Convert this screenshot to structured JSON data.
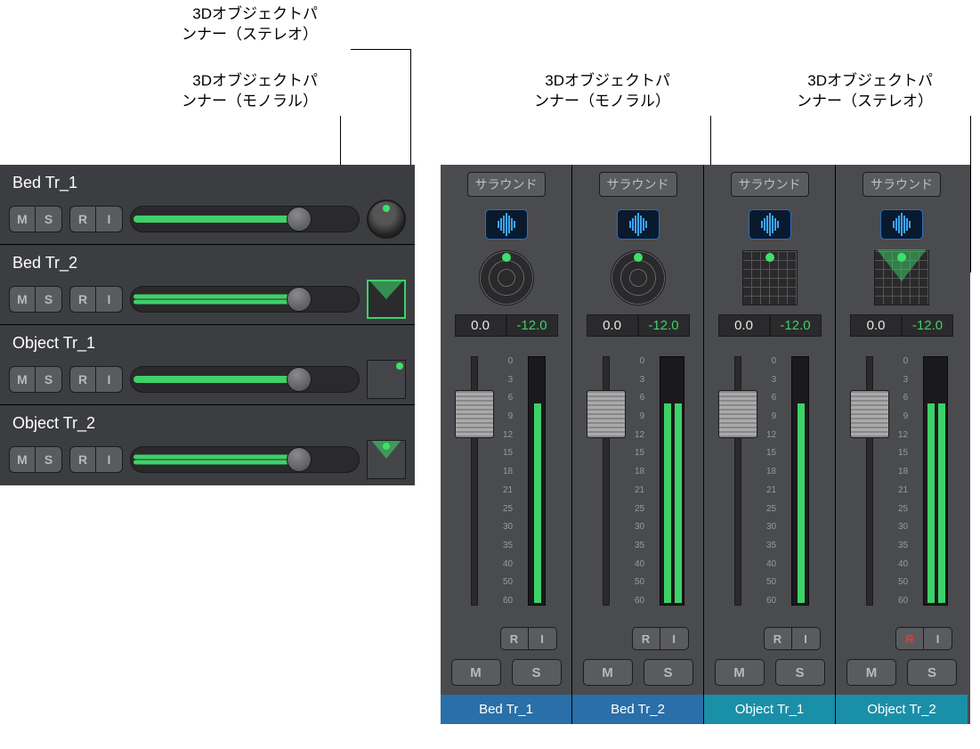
{
  "callouts": {
    "left_mono": "3Dオブジェクトパ\nンナー（モノラル）",
    "left_stereo": "3Dオブジェクトパ\nンナー（ステレオ）",
    "right_mono": "3Dオブジェクトパ\nンナー（モノラル）",
    "right_stereo": "3Dオブジェクトパ\nンナー（ステレオ）"
  },
  "tracks": [
    {
      "name": "Bed Tr_1",
      "stereo": false,
      "panner": "round"
    },
    {
      "name": "Bed Tr_2",
      "stereo": true,
      "panner": "surround"
    },
    {
      "name": "Object Tr_1",
      "stereo": false,
      "panner": "mono3d"
    },
    {
      "name": "Object Tr_2",
      "stereo": true,
      "panner": "stereo3d"
    }
  ],
  "track_buttons": {
    "M": "M",
    "S": "S",
    "R": "R",
    "I": "I"
  },
  "channels": [
    {
      "name": "Bed Tr_1",
      "kind": "bed",
      "surround_label": "サラウンド",
      "panner": "round",
      "db_pan": "0.0",
      "db_vol": "-12.0",
      "stereo": false,
      "r_red": false
    },
    {
      "name": "Bed Tr_2",
      "kind": "bed",
      "surround_label": "サラウンド",
      "panner": "round",
      "db_pan": "0.0",
      "db_vol": "-12.0",
      "stereo": true,
      "r_red": false
    },
    {
      "name": "Object Tr_1",
      "kind": "obj",
      "surround_label": "サラウンド",
      "panner": "grid-mono",
      "db_pan": "0.0",
      "db_vol": "-12.0",
      "stereo": false,
      "r_red": false
    },
    {
      "name": "Object Tr_2",
      "kind": "obj",
      "surround_label": "サラウンド",
      "panner": "grid-stereo",
      "db_pan": "0.0",
      "db_vol": "-12.0",
      "stereo": true,
      "r_red": true
    }
  ],
  "scale_ticks": [
    "0",
    "3",
    "6",
    "9",
    "12",
    "15",
    "18",
    "21",
    "25",
    "30",
    "35",
    "40",
    "50",
    "60"
  ],
  "ch_buttons": {
    "R": "R",
    "I": "I",
    "M": "M",
    "S": "S"
  }
}
